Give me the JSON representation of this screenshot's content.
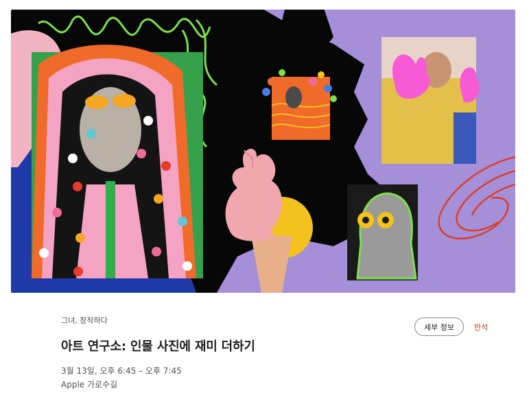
{
  "hero": {
    "image_name": "art-lab-portraits-collage",
    "colors": {
      "background": "#070707",
      "purple": "#a58fd8",
      "green": "#7ee04a",
      "red": "#d7402a",
      "pink": "#f2a3c4",
      "yellow": "#f4c21c"
    }
  },
  "event": {
    "category": "그녀, 창작하다",
    "title": "아트 연구소: 인물 사진에 재미 더하기",
    "datetime": "3월 13일, 오후 6:45 – 오후 7:45",
    "location": "Apple 가로수길"
  },
  "actions": {
    "details_label": "세부 정보",
    "status_label": "만석",
    "status_color": "#b64400"
  }
}
